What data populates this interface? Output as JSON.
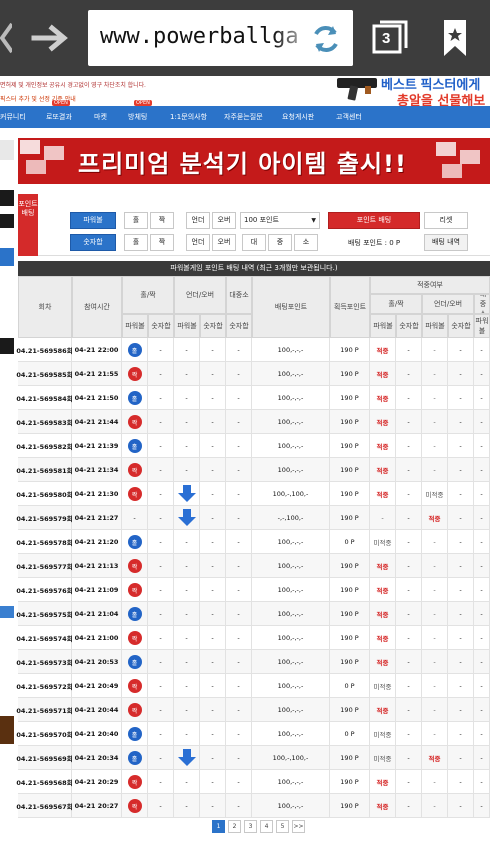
{
  "browser": {
    "url_text": "www.powerballga",
    "tab_count": "3"
  },
  "site": {
    "notice_line1": "면허제 및 개인정보 공유시 경고없이 영구 차단조치 합니다.",
    "notice_line2": "픽스터 추가 및 선정 기준 안내",
    "ad_line1": "베스트 픽스터에게",
    "ad_line2": "총알을 선물해보세요!",
    "nav": [
      {
        "label": "커뮤니티",
        "open": false
      },
      {
        "label": "로또결과",
        "open": true
      },
      {
        "label": "마켓",
        "open": false
      },
      {
        "label": "방체팅",
        "open": true
      },
      {
        "label": "1:1문의사항",
        "open": false
      },
      {
        "label": "자주묻는질문",
        "open": false
      },
      {
        "label": "요청게시판",
        "open": false
      },
      {
        "label": "고객센터",
        "open": false
      }
    ],
    "open_badge": "OPEN",
    "banner_text": "프리미엄 분석기 아이템 출시!!"
  },
  "panel": {
    "side_label": "포인트배팅",
    "powerball_label": "파워볼",
    "number_sum_label": "숫자합",
    "odd": "홀",
    "even": "짝",
    "under": "언더",
    "over": "오버",
    "large": "대",
    "medium": "중",
    "small": "소",
    "point_select": "100 포인트",
    "bet_button": "포인트 배팅",
    "reset_button": "리셋",
    "bet_point_label": "배팅 포인트 : 0 P",
    "bet_history_button": "배팅 내역"
  },
  "table": {
    "title": "파워볼게임 포인트 배팅 내역 (최근 3개월만 보관됩니다.)",
    "headers": {
      "round": "회차",
      "time": "참여시간",
      "odd_even": "홀/짝",
      "under_over": "언더/오버",
      "size": "대중소",
      "bet_point": "배팅포인트",
      "win_point": "획득포인트",
      "result": "적중여부",
      "powerball": "파워볼",
      "number_sum": "숫자합"
    },
    "rows": [
      {
        "round": "04.21-569586회",
        "time": "04-21 22:00",
        "oe": "홀",
        "oe_color": "blue",
        "uo": "",
        "bet": "100,-,-,-",
        "win": "190 P",
        "r_oe": "적중",
        "r_uo": "",
        "r_hit": true
      },
      {
        "round": "04.21-569585회",
        "time": "04-21 21:55",
        "oe": "짝",
        "oe_color": "red",
        "uo": "",
        "bet": "100,-,-,-",
        "win": "190 P",
        "r_oe": "적중",
        "r_uo": "",
        "r_hit": true
      },
      {
        "round": "04.21-569584회",
        "time": "04-21 21:50",
        "oe": "홀",
        "oe_color": "blue",
        "uo": "",
        "bet": "100,-,-,-",
        "win": "190 P",
        "r_oe": "적중",
        "r_uo": "",
        "r_hit": true
      },
      {
        "round": "04.21-569583회",
        "time": "04-21 21:44",
        "oe": "짝",
        "oe_color": "red",
        "uo": "",
        "bet": "100,-,-,-",
        "win": "190 P",
        "r_oe": "적중",
        "r_uo": "",
        "r_hit": true
      },
      {
        "round": "04.21-569582회",
        "time": "04-21 21:39",
        "oe": "홀",
        "oe_color": "blue",
        "uo": "",
        "bet": "100,-,-,-",
        "win": "190 P",
        "r_oe": "적중",
        "r_uo": "",
        "r_hit": true
      },
      {
        "round": "04.21-569581회",
        "time": "04-21 21:34",
        "oe": "짝",
        "oe_color": "red",
        "uo": "",
        "bet": "100,-,-,-",
        "win": "190 P",
        "r_oe": "적중",
        "r_uo": "",
        "r_hit": true
      },
      {
        "round": "04.21-569580회",
        "time": "04-21 21:30",
        "oe": "짝",
        "oe_color": "red",
        "uo": "down",
        "bet": "100,-,100,-",
        "win": "190 P",
        "r_oe": "적중",
        "r_uo": "미적중",
        "r_hit": true
      },
      {
        "round": "04.21-569579회",
        "time": "04-21 21:27",
        "oe": "-",
        "oe_color": "",
        "uo": "down",
        "bet": "-,-,100,-",
        "win": "190 P",
        "r_oe": "-",
        "r_uo": "적중",
        "r_hit": false
      },
      {
        "round": "04.21-569578회",
        "time": "04-21 21:20",
        "oe": "홀",
        "oe_color": "blue",
        "uo": "",
        "bet": "100,-,-,-",
        "win": "0 P",
        "r_oe": "미적중",
        "r_uo": "",
        "r_hit": false
      },
      {
        "round": "04.21-569577회",
        "time": "04-21 21:13",
        "oe": "짝",
        "oe_color": "red",
        "uo": "",
        "bet": "100,-,-,-",
        "win": "190 P",
        "r_oe": "적중",
        "r_uo": "",
        "r_hit": true
      },
      {
        "round": "04.21-569576회",
        "time": "04-21 21:09",
        "oe": "짝",
        "oe_color": "red",
        "uo": "",
        "bet": "100,-,-,-",
        "win": "190 P",
        "r_oe": "적중",
        "r_uo": "",
        "r_hit": true
      },
      {
        "round": "04.21-569575회",
        "time": "04-21 21:04",
        "oe": "홀",
        "oe_color": "blue",
        "uo": "",
        "bet": "100,-,-,-",
        "win": "190 P",
        "r_oe": "적중",
        "r_uo": "",
        "r_hit": true
      },
      {
        "round": "04.21-569574회",
        "time": "04-21 21:00",
        "oe": "짝",
        "oe_color": "red",
        "uo": "",
        "bet": "100,-,-,-",
        "win": "190 P",
        "r_oe": "적중",
        "r_uo": "",
        "r_hit": true
      },
      {
        "round": "04.21-569573회",
        "time": "04-21 20:53",
        "oe": "홀",
        "oe_color": "blue",
        "uo": "",
        "bet": "100,-,-,-",
        "win": "190 P",
        "r_oe": "적중",
        "r_uo": "",
        "r_hit": true
      },
      {
        "round": "04.21-569572회",
        "time": "04-21 20:49",
        "oe": "짝",
        "oe_color": "red",
        "uo": "",
        "bet": "100,-,-,-",
        "win": "0 P",
        "r_oe": "미적중",
        "r_uo": "",
        "r_hit": false
      },
      {
        "round": "04.21-569571회",
        "time": "04-21 20:44",
        "oe": "짝",
        "oe_color": "red",
        "uo": "",
        "bet": "100,-,-,-",
        "win": "190 P",
        "r_oe": "적중",
        "r_uo": "",
        "r_hit": true
      },
      {
        "round": "04.21-569570회",
        "time": "04-21 20:40",
        "oe": "홀",
        "oe_color": "blue",
        "uo": "",
        "bet": "100,-,-,-",
        "win": "0 P",
        "r_oe": "미적중",
        "r_uo": "",
        "r_hit": false
      },
      {
        "round": "04.21-569569회",
        "time": "04-21 20:34",
        "oe": "홀",
        "oe_color": "blue",
        "uo": "down",
        "bet": "100,-,100,-",
        "win": "190 P",
        "r_oe": "미적중",
        "r_uo": "적중",
        "r_hit": false
      },
      {
        "round": "04.21-569568회",
        "time": "04-21 20:29",
        "oe": "짝",
        "oe_color": "red",
        "uo": "",
        "bet": "100,-,-,-",
        "win": "190 P",
        "r_oe": "적중",
        "r_uo": "",
        "r_hit": true
      },
      {
        "round": "04.21-569567회",
        "time": "04-21 20:27",
        "oe": "짝",
        "oe_color": "red",
        "uo": "",
        "bet": "100,-,-,-",
        "win": "190 P",
        "r_oe": "적중",
        "r_uo": "",
        "r_hit": true
      }
    ]
  },
  "pagination": {
    "pages": [
      "1",
      "2",
      "3",
      "4",
      "5"
    ],
    "next": ">>",
    "active": "1"
  },
  "colors": {
    "nav_blue": "#2b73c9",
    "hit_red": "#d62b2b",
    "ball_blue": "#2264c6",
    "ball_red": "#d62b2b",
    "chrome": "#3d3d3d"
  }
}
